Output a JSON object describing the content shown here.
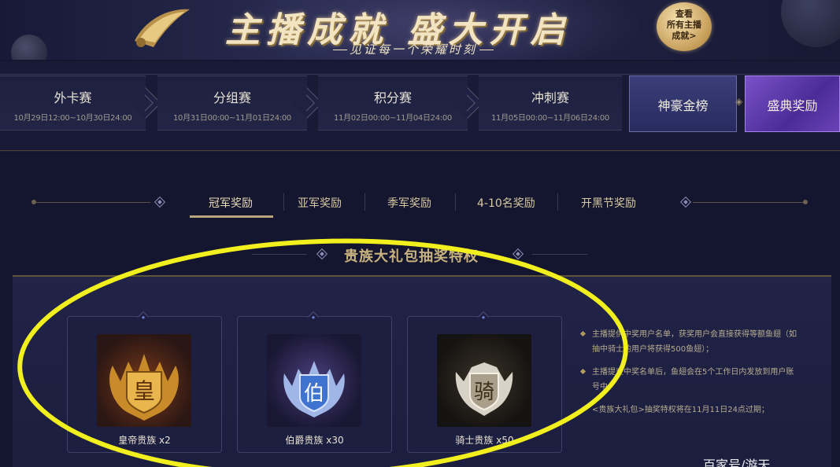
{
  "banner": {
    "title": "主播成就  盛大开启",
    "subtitle": "见证每一个荣耀时刻",
    "view_all": [
      "查看",
      "所有主播",
      "成就>"
    ]
  },
  "stages": [
    {
      "name": "外卡赛",
      "time": "10月29日12:00~10月30日24:00"
    },
    {
      "name": "分组赛",
      "time": "10月31日00:00~11月01日24:00"
    },
    {
      "name": "积分赛",
      "time": "11月02日00:00~11月04日24:00"
    },
    {
      "name": "冲刺赛",
      "time": "11月05日00:00~11月06日24:00"
    }
  ],
  "special_stages": {
    "gold_rank": "神豪金榜",
    "gala_rewards": "盛典奖励"
  },
  "reward_tabs": [
    "冠军奖励",
    "亚军奖励",
    "季军奖励",
    "4-10名奖励",
    "开黑节奖励"
  ],
  "active_tab": "冠军奖励",
  "section": {
    "title": "贵族大礼包抽奖特权"
  },
  "cards": [
    {
      "label": "皇帝贵族 x2",
      "emblem_char": "皇",
      "theme": "gold"
    },
    {
      "label": "伯爵贵族 x30",
      "emblem_char": "伯",
      "theme": "blue"
    },
    {
      "label": "骑士贵族 x50",
      "emblem_char": "骑",
      "theme": "silver"
    }
  ],
  "notes": [
    "主播提供中奖用户名单，获奖用户会直接获得等额鱼翅（如抽中骑士的用户将获得500鱼翅）；",
    "主播提交中奖名单后，鱼翅会在5个工作日内发放到用户账号中；",
    "<贵族大礼包>抽奖特权将在11月11日24点过期；"
  ],
  "watermark": "百家号/游天",
  "colors": {
    "background": "#14152e",
    "gold_text": "#c8b27f",
    "annotation": "#f2ef1e",
    "gala_purple": "#7a52c9"
  }
}
